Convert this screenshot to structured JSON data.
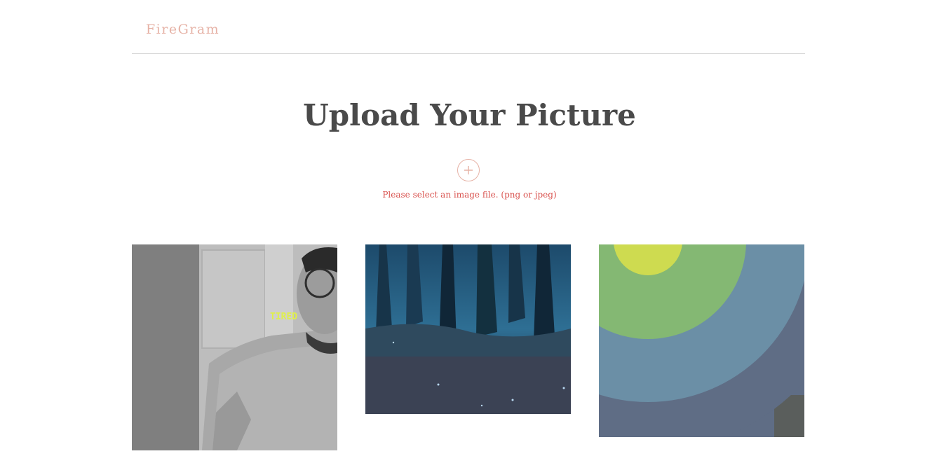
{
  "navbar": {
    "brand": "FireGram"
  },
  "title": "Upload Your Picture",
  "upload": {
    "icon": "plus-icon",
    "error": "Please select an image file. (png or jpeg)"
  },
  "colors": {
    "brand": "#e6b2a6",
    "error": "#d9534f",
    "title": "#4a4a4a",
    "divider": "#d9d9d9"
  },
  "gallery": [
    {
      "caption": "TIRED"
    },
    {
      "caption": ""
    },
    {
      "caption": ""
    }
  ]
}
